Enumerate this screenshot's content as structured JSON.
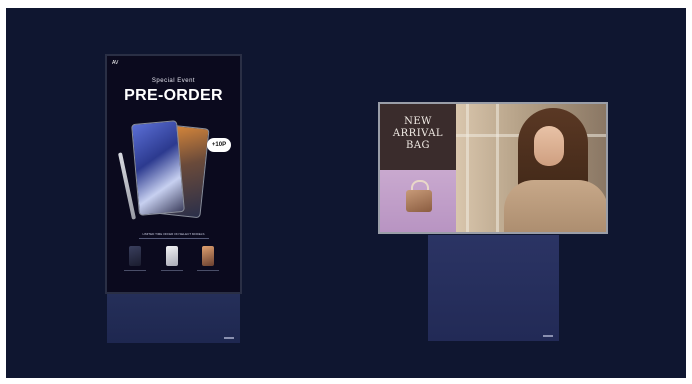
{
  "vertical_display": {
    "logo_text": "AV",
    "subtitle": "Special Event",
    "headline": "PRE-ORDER",
    "badge": "+10P",
    "promo_text": "LIMITED TIME OFFER ON SELECT MODELS"
  },
  "horizontal_display": {
    "headline": "NEW\nARRIVAL\nBAG"
  }
}
